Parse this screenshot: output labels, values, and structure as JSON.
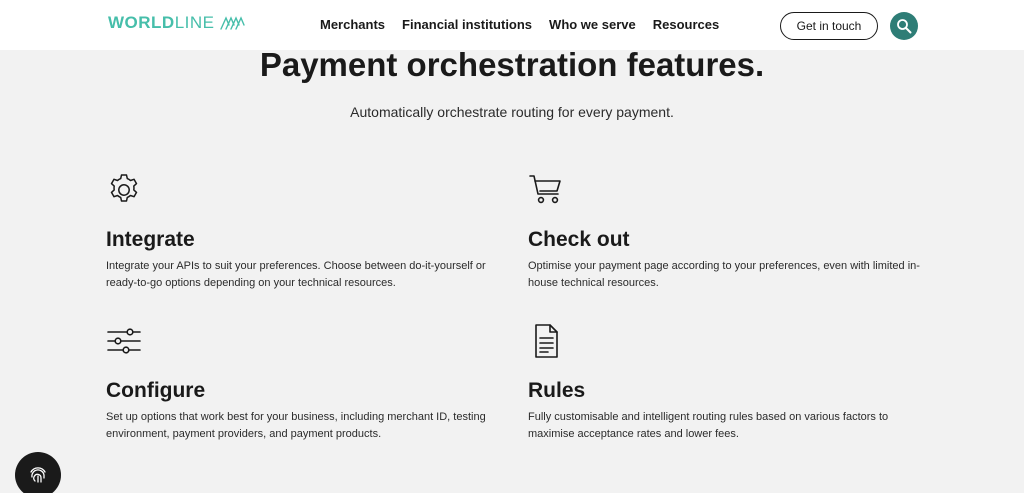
{
  "header": {
    "logo": {
      "text_bold": "WORLD",
      "text_light": "LINE",
      "icon": "worldline-waves-icon",
      "color": "#46beaa"
    },
    "nav": [
      {
        "label": "Merchants"
      },
      {
        "label": "Financial institutions"
      },
      {
        "label": "Who we serve"
      },
      {
        "label": "Resources"
      }
    ],
    "cta_label": "Get in touch",
    "search_icon": "search-icon",
    "accent": "#2e7d76"
  },
  "main": {
    "title": "Payment orchestration features.",
    "subtitle": "Automatically orchestrate routing for every payment.",
    "features": [
      {
        "icon": "gear-icon",
        "title": "Integrate",
        "desc": "Integrate your APIs to suit your preferences. Choose between do-it-yourself or ready-to-go options depending on your technical resources."
      },
      {
        "icon": "cart-icon",
        "title": "Check out",
        "desc": "Optimise your payment page according to your preferences, even with limited in-house technical resources."
      },
      {
        "icon": "sliders-icon",
        "title": "Configure",
        "desc": "Set up options that work best for your business, including merchant ID, testing environment, payment providers, and payment products."
      },
      {
        "icon": "document-icon",
        "title": "Rules",
        "desc": "Fully customisable and intelligent routing rules based on various factors to maximise acceptance rates and lower fees."
      }
    ]
  },
  "floating": {
    "icon": "fingerprint-icon"
  }
}
